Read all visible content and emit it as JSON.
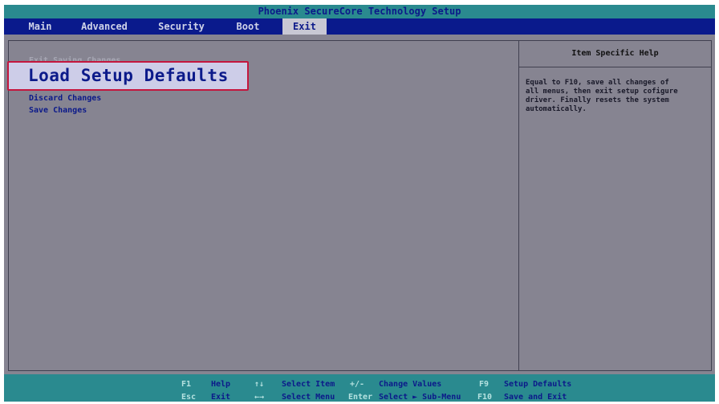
{
  "title": "Phoenix SecureCore Technology Setup",
  "tabs": [
    {
      "label": "Main"
    },
    {
      "label": "Advanced"
    },
    {
      "label": "Security"
    },
    {
      "label": "Boot"
    },
    {
      "label": "Exit"
    }
  ],
  "menu": {
    "items": [
      {
        "label": "Exit Saving Changes"
      },
      {
        "label": "Load Setup Defaults"
      },
      {
        "label": "Discard Changes"
      },
      {
        "label": "Save Changes"
      }
    ]
  },
  "help": {
    "heading": "Item Specific Help",
    "lines": [
      "Equal to F10, save all changes of",
      "all menus, then exit setup cofigure",
      "driver. Finally resets the system",
      "automatically."
    ]
  },
  "footer": [
    {
      "key": "F1",
      "label": "Help"
    },
    {
      "key": "↑↓",
      "label": "Select Item"
    },
    {
      "key": "+/-",
      "label": "Change Values"
    },
    {
      "key": "F9",
      "label": "Setup Defaults"
    },
    {
      "key": "Esc",
      "label": "Exit"
    },
    {
      "key": "←→",
      "label": "Select Menu"
    },
    {
      "key": "Enter",
      "label": "Select ► Sub-Menu"
    },
    {
      "key": "F10",
      "label": "Save and Exit"
    }
  ],
  "colors": {
    "background": "#868491",
    "title_bar": "#2a8a8f",
    "menu_bar": "#0a1a8c",
    "text_blue": "#0c1a8a",
    "selection_border": "#c4163e"
  }
}
